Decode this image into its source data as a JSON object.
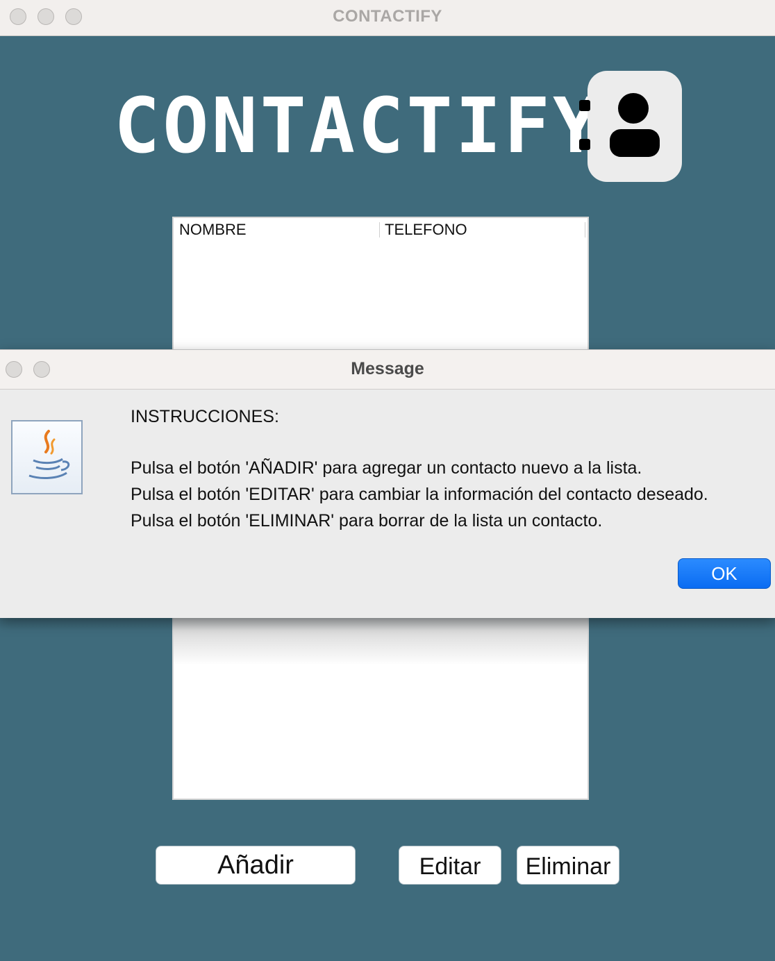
{
  "window": {
    "title": "CONTACTIFY"
  },
  "app": {
    "heading": "CONTACTIFY",
    "logo_icon": "contact-book-icon",
    "table": {
      "columns": [
        "NOMBRE",
        "TELEFONO"
      ],
      "rows": []
    },
    "buttons": {
      "add": "Añadir",
      "edit": "Editar",
      "delete": "Eliminar"
    },
    "colors": {
      "background": "#3f6b7c",
      "accent": "#0a6cf2"
    }
  },
  "dialog": {
    "title": "Message",
    "icon": "java-icon",
    "heading": "INSTRUCCIONES:",
    "lines": [
      "Pulsa el botón 'AÑADIR' para agregar un contacto nuevo a la lista.",
      "Pulsa el botón 'EDITAR' para cambiar la información del contacto deseado.",
      "Pulsa el botón 'ELIMINAR' para borrar de la lista un contacto."
    ],
    "ok_label": "OK"
  }
}
